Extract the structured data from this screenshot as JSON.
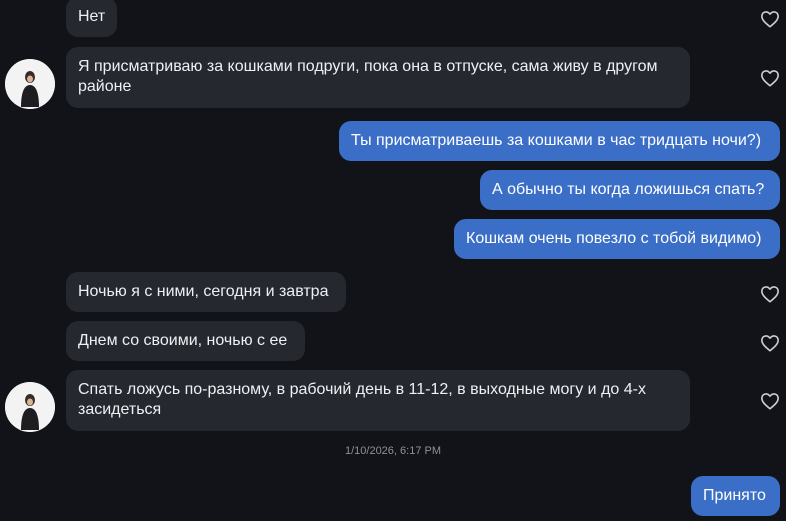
{
  "messages": [
    {
      "id": "m1",
      "direction": "incoming",
      "text": "Нет"
    },
    {
      "id": "m2",
      "direction": "incoming",
      "text": "Я присматриваю за кошками подруги, пока она в отпуске, сама живу в другом районе"
    },
    {
      "id": "m3",
      "direction": "outgoing",
      "text": "Ты присматриваешь за кошками в час тридцать ночи?)"
    },
    {
      "id": "m4",
      "direction": "outgoing",
      "text": "А обычно ты когда ложишься спать?"
    },
    {
      "id": "m5",
      "direction": "outgoing",
      "text": "Кошкам очень повезло с тобой видимо)"
    },
    {
      "id": "m6",
      "direction": "incoming",
      "text": "Ночью я с ними, сегодня и завтра"
    },
    {
      "id": "m7",
      "direction": "incoming",
      "text": "Днем со своими, ночью с ее"
    },
    {
      "id": "m8",
      "direction": "incoming",
      "text": "Спать ложусь по-разному, в рабочий день в 11-12, в выходные могу и до 4-х засидеться"
    },
    {
      "id": "m9",
      "direction": "outgoing",
      "text": "Принято"
    }
  ],
  "timestamp": "1/10/2026, 6:17 PM",
  "icons": {
    "like": "heart-outline-icon",
    "avatar": "user-avatar"
  },
  "colors": {
    "background": "#121318",
    "incoming_bubble": "#25282e",
    "outgoing_bubble": "#3b6fc7",
    "text": "#eef0f4",
    "muted": "#8d9099"
  }
}
